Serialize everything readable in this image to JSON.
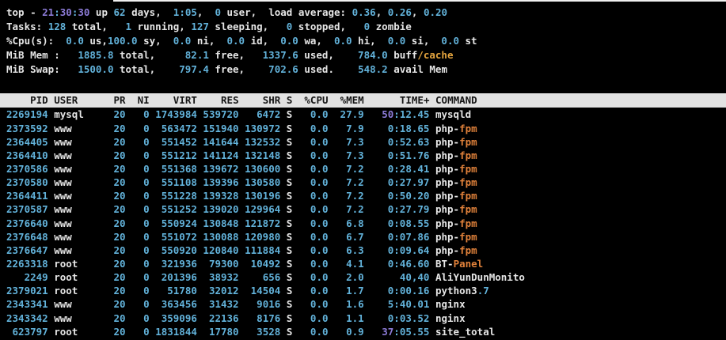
{
  "colors": {
    "background": "#000000",
    "text": "#e6e6e6",
    "number": "#62b2da",
    "purple": "#8d7cd8",
    "orange": "#e0813a",
    "gold": "#e4a43e",
    "header_bg": "#e2e2e2",
    "header_text": "#141414",
    "strip": "#f0f0f0"
  },
  "terminal": {
    "summary_lines": [
      [
        [
          "w",
          "top - "
        ],
        [
          "p",
          "21"
        ],
        [
          "n",
          ":"
        ],
        [
          "p",
          "30"
        ],
        [
          "n",
          ":"
        ],
        [
          "p",
          "30"
        ],
        [
          "w",
          " up "
        ],
        [
          "n",
          "62"
        ],
        [
          "w",
          " days,  "
        ],
        [
          "n",
          "1:05"
        ],
        [
          "w",
          ",  "
        ],
        [
          "n",
          "0"
        ],
        [
          "w",
          " user,  load average: "
        ],
        [
          "n",
          "0.36"
        ],
        [
          "w",
          ", "
        ],
        [
          "n",
          "0.26"
        ],
        [
          "w",
          ", "
        ],
        [
          "n",
          "0.20"
        ]
      ],
      [
        [
          "w",
          "Tasks: "
        ],
        [
          "n",
          "128"
        ],
        [
          "w",
          " total,   "
        ],
        [
          "n",
          "1"
        ],
        [
          "w",
          " running, "
        ],
        [
          "n",
          "127"
        ],
        [
          "w",
          " sleeping,   "
        ],
        [
          "n",
          "0"
        ],
        [
          "w",
          " stopped,   "
        ],
        [
          "n",
          "0"
        ],
        [
          "w",
          " zombie"
        ]
      ],
      [
        [
          "w",
          "%Cpu(s):  "
        ],
        [
          "n",
          "0.0"
        ],
        [
          "w",
          " us,"
        ],
        [
          "n",
          "100.0"
        ],
        [
          "w",
          " sy,  "
        ],
        [
          "n",
          "0.0"
        ],
        [
          "w",
          " ni,  "
        ],
        [
          "n",
          "0.0"
        ],
        [
          "w",
          " id,  "
        ],
        [
          "n",
          "0.0"
        ],
        [
          "w",
          " wa,  "
        ],
        [
          "n",
          "0.0"
        ],
        [
          "w",
          " hi,  "
        ],
        [
          "n",
          "0.0"
        ],
        [
          "w",
          " si,  "
        ],
        [
          "n",
          "0.0"
        ],
        [
          "w",
          " st"
        ]
      ],
      [
        [
          "w",
          "MiB Mem :   "
        ],
        [
          "n",
          "1885.8"
        ],
        [
          "w",
          " total,     "
        ],
        [
          "n",
          "82.1"
        ],
        [
          "w",
          " free,   "
        ],
        [
          "n",
          "1337.6"
        ],
        [
          "w",
          " used,    "
        ],
        [
          "n",
          "784.0"
        ],
        [
          "w",
          " buff"
        ],
        [
          "g",
          "/cache"
        ]
      ],
      [
        [
          "w",
          "MiB Swap:   "
        ],
        [
          "n",
          "1500.0"
        ],
        [
          "w",
          " total,    "
        ],
        [
          "n",
          "797.4"
        ],
        [
          "w",
          " free,    "
        ],
        [
          "n",
          "702.6"
        ],
        [
          "w",
          " used.    "
        ],
        [
          "n",
          "548.2"
        ],
        [
          "w",
          " avail Mem"
        ]
      ]
    ],
    "table": {
      "columns": [
        "PID",
        "USER",
        "PR",
        "NI",
        "VIRT",
        "RES",
        "SHR",
        "S",
        "%CPU",
        "%MEM",
        "TIME+",
        "COMMAND"
      ],
      "rows": [
        [
          "2269194",
          "mysql",
          "20",
          "0",
          "1743984",
          "539720",
          "6472",
          "S",
          "0.0",
          "27.9",
          [
            [
              "p",
              "50"
            ],
            [
              "n",
              ":12.45"
            ]
          ],
          "mysqld"
        ],
        [
          "2373592",
          "www",
          "20",
          "0",
          "563472",
          "151940",
          "130972",
          "S",
          "0.0",
          "7.9",
          "0:18.65",
          [
            [
              "w",
              "php-"
            ],
            [
              "o",
              "fpm"
            ]
          ]
        ],
        [
          "2364405",
          "www",
          "20",
          "0",
          "551452",
          "141644",
          "132532",
          "S",
          "0.0",
          "7.3",
          "0:52.63",
          [
            [
              "w",
              "php-"
            ],
            [
              "o",
              "fpm"
            ]
          ]
        ],
        [
          "2364410",
          "www",
          "20",
          "0",
          "551212",
          "141124",
          "132148",
          "S",
          "0.0",
          "7.3",
          "0:51.76",
          [
            [
              "w",
              "php-"
            ],
            [
              "o",
              "fpm"
            ]
          ]
        ],
        [
          "2370586",
          "www",
          "20",
          "0",
          "551368",
          "139672",
          "130600",
          "S",
          "0.0",
          "7.2",
          "0:28.41",
          [
            [
              "w",
              "php-"
            ],
            [
              "o",
              "fpm"
            ]
          ]
        ],
        [
          "2370580",
          "www",
          "20",
          "0",
          "551108",
          "139396",
          "130580",
          "S",
          "0.0",
          "7.2",
          "0:27.97",
          [
            [
              "w",
              "php-"
            ],
            [
              "o",
              "fpm"
            ]
          ]
        ],
        [
          "2364411",
          "www",
          "20",
          "0",
          "551228",
          "139328",
          "130196",
          "S",
          "0.0",
          "7.2",
          "0:50.20",
          [
            [
              "w",
              "php-"
            ],
            [
              "o",
              "fpm"
            ]
          ]
        ],
        [
          "2370587",
          "www",
          "20",
          "0",
          "551252",
          "139020",
          "129964",
          "S",
          "0.0",
          "7.2",
          "0:27.79",
          [
            [
              "w",
              "php-"
            ],
            [
              "o",
              "fpm"
            ]
          ]
        ],
        [
          "2376640",
          "www",
          "20",
          "0",
          "550924",
          "130848",
          "121872",
          "S",
          "0.0",
          "6.8",
          "0:08.55",
          [
            [
              "w",
              "php-"
            ],
            [
              "o",
              "fpm"
            ]
          ]
        ],
        [
          "2376648",
          "www",
          "20",
          "0",
          "551072",
          "130088",
          "120980",
          "S",
          "0.0",
          "6.7",
          "0:07.86",
          [
            [
              "w",
              "php-"
            ],
            [
              "o",
              "fpm"
            ]
          ]
        ],
        [
          "2376647",
          "www",
          "20",
          "0",
          "550920",
          "120840",
          "111884",
          "S",
          "0.0",
          "6.3",
          "0:09.64",
          [
            [
              "w",
              "php-"
            ],
            [
              "o",
              "fpm"
            ]
          ]
        ],
        [
          "2263318",
          "root",
          "20",
          "0",
          "321936",
          "79300",
          "10492",
          "S",
          "0.0",
          "4.1",
          "0:46.60",
          [
            [
              "w",
              "BT-"
            ],
            [
              "o",
              "Panel"
            ]
          ]
        ],
        [
          "2249",
          "root",
          "20",
          "0",
          "201396",
          "38932",
          "656",
          "S",
          "0.0",
          "2.0",
          "40,40",
          "AliYunDunMonito"
        ],
        [
          "2379021",
          "root",
          "20",
          "0",
          "51780",
          "32012",
          "14504",
          "S",
          "0.0",
          "1.7",
          "0:00.16",
          [
            [
              "w",
              "python3"
            ],
            [
              "n",
              ".7"
            ]
          ]
        ],
        [
          "2343341",
          "www",
          "20",
          "0",
          "363456",
          "31432",
          "9016",
          "S",
          "0.0",
          "1.6",
          "5:40.01",
          "nginx"
        ],
        [
          "2343342",
          "www",
          "20",
          "0",
          "359096",
          "22136",
          "8176",
          "S",
          "0.0",
          "1.1",
          "0:03.52",
          "nginx"
        ],
        [
          "623797",
          "root",
          "20",
          "0",
          "1831844",
          "17780",
          "3528",
          "S",
          "0.0",
          "0.9",
          [
            [
              "p",
              "37"
            ],
            [
              "n",
              ":05.55"
            ]
          ],
          "site_total"
        ]
      ]
    }
  }
}
